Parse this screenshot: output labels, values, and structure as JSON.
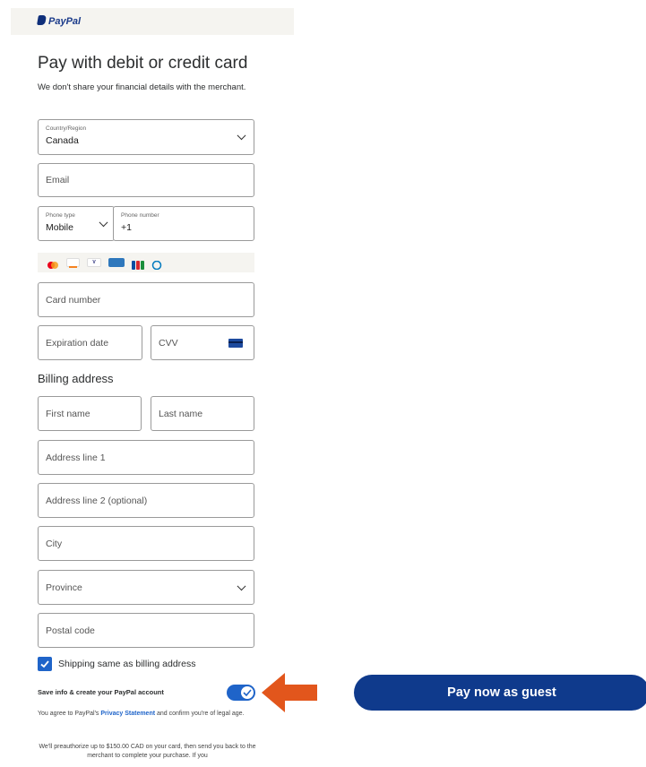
{
  "header": {
    "logo_text": "PayPal"
  },
  "title": "Pay with debit or credit card",
  "subtitle": "We don't share your financial details with the merchant.",
  "country": {
    "label": "Country/Region",
    "value": "Canada"
  },
  "email": {
    "placeholder": "Email"
  },
  "phone": {
    "type_label": "Phone type",
    "type_value": "Mobile",
    "number_label": "Phone number",
    "number_value": "+1"
  },
  "card_brands": [
    "mastercard-icon",
    "discover-icon",
    "visa-icon",
    "amex-icon",
    "jcb-icon",
    "diners-icon"
  ],
  "card_number": {
    "placeholder": "Card number"
  },
  "expiration": {
    "placeholder": "Expiration date"
  },
  "cvv": {
    "placeholder": "CVV"
  },
  "billing": {
    "heading": "Billing address",
    "first_name": "First name",
    "last_name": "Last name",
    "address1": "Address line 1",
    "address2": "Address line 2 (optional)",
    "city": "City",
    "province": "Province",
    "postal": "Postal code"
  },
  "shipping_same": {
    "label": "Shipping same as billing address",
    "checked": true
  },
  "save_info": {
    "label": "Save info & create your PayPal account",
    "enabled": true
  },
  "agree": {
    "prefix": "You agree to PayPal's",
    "link": "Privacy Statement",
    "suffix": "and confirm you're of legal age."
  },
  "preauth": "We'll preauthorize up to $150.00 CAD on your card, then send you back to the merchant to complete your purchase. If you",
  "pay_button": "Pay now as guest",
  "colors": {
    "primary": "#1f64c9",
    "button": "#0f3a8c",
    "arrow": "#e2561c"
  }
}
